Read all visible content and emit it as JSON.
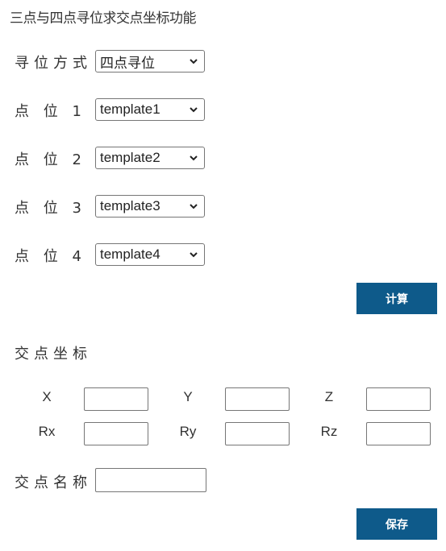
{
  "header": {
    "title": "三点与四点寻位求交点坐标功能"
  },
  "form": {
    "mode_label": "寻位方式",
    "mode_value": "四点寻位",
    "points": [
      {
        "label": "点 位 1",
        "value": "template1"
      },
      {
        "label": "点 位 2",
        "value": "template2"
      },
      {
        "label": "点 位 3",
        "value": "template3"
      },
      {
        "label": "点 位 4",
        "value": "template4"
      }
    ],
    "calc_button": "计算"
  },
  "result": {
    "section_label": "交点坐标",
    "coords": [
      {
        "label": "X",
        "value": ""
      },
      {
        "label": "Y",
        "value": ""
      },
      {
        "label": "Z",
        "value": ""
      },
      {
        "label": "Rx",
        "value": ""
      },
      {
        "label": "Ry",
        "value": ""
      },
      {
        "label": "Rz",
        "value": ""
      }
    ],
    "name_label": "交点名称",
    "name_value": "",
    "save_button": "保存"
  },
  "colors": {
    "button_bg": "#0e5a8a",
    "button_text": "#ffffff"
  },
  "icons": {
    "select_arrow": "chevron-down-icon"
  }
}
